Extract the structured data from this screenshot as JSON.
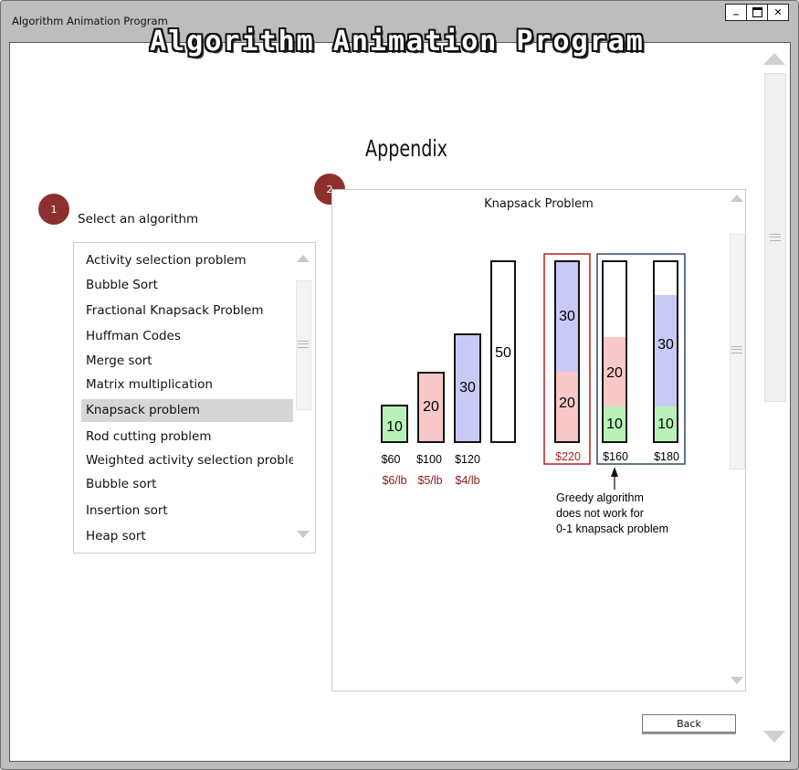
{
  "window": {
    "title": "Algorithm Animation Program",
    "minimize_label": "_",
    "maximize_label": "□",
    "close_label": "✕"
  },
  "header": {
    "app_title": "Algorithm Animation Program",
    "page_title": "Appendix"
  },
  "step1": {
    "badge": "1",
    "label": "Select an algorithm"
  },
  "step2": {
    "badge": "2"
  },
  "algorithm_list": {
    "items": [
      "Activity selection problem",
      "Bubble Sort",
      "Fractional Knapsack Problem",
      "Huffman Codes",
      "Merge sort",
      "Matrix multiplication",
      "Knapsack problem",
      "Rod cutting problem",
      "Weighted activity selection proble",
      "Bubble sort",
      "Insertion sort",
      "Heap sort"
    ],
    "selected_index": 6
  },
  "panel": {
    "title": "Knapsack Problem"
  },
  "knapsack_figure": {
    "items": [
      {
        "weight": "10",
        "price": "$60",
        "rate": "$6/lb",
        "color": "#b9f2b9"
      },
      {
        "weight": "20",
        "price": "$100",
        "rate": "$5/lb",
        "color": "#f9c8c8"
      },
      {
        "weight": "30",
        "price": "$120",
        "rate": "$4/lb",
        "color": "#c9c9f5"
      },
      {
        "weight": "50"
      }
    ],
    "solutions": [
      {
        "total": "$220",
        "stack": [
          "20",
          "30"
        ],
        "highlight": "#b22222"
      },
      {
        "total": "$160",
        "stack": [
          "10",
          "20"
        ]
      },
      {
        "total": "$180",
        "stack": [
          "10",
          "30"
        ]
      }
    ],
    "note_lines": [
      "Greedy algorithm",
      "does not work for",
      "0-1 knapsack problem"
    ],
    "rate_color": "#8b1a1a",
    "greedy_frame_color": "#2e4a6b"
  },
  "footer": {
    "back_label": "Back"
  }
}
